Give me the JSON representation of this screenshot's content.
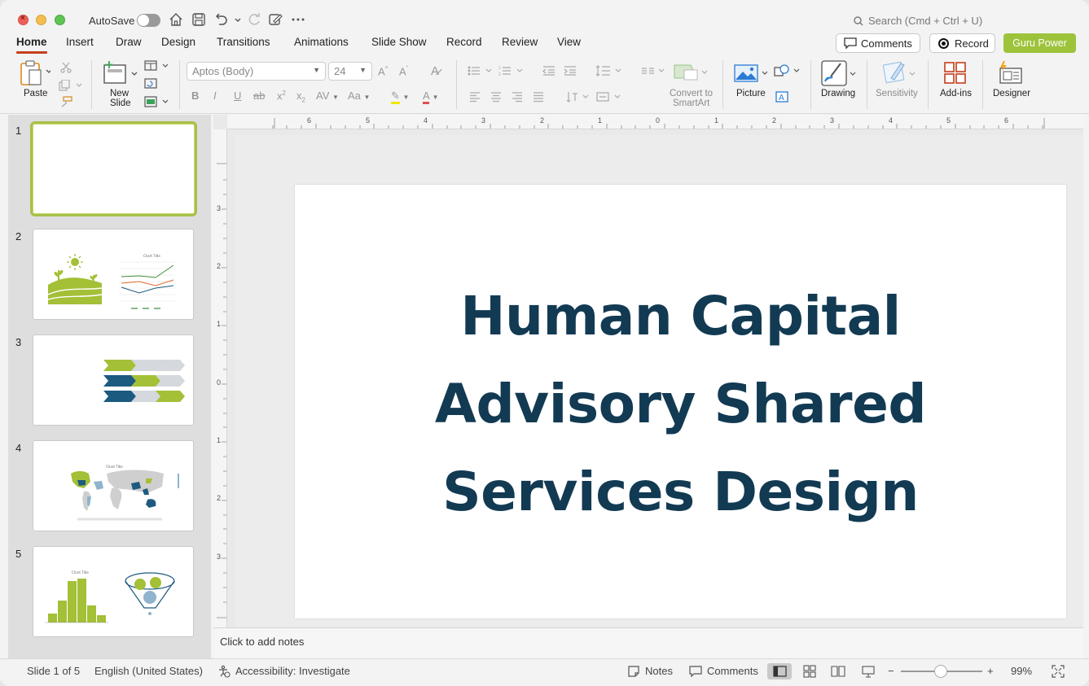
{
  "titlebar": {
    "autosave_label": "AutoSave",
    "search_placeholder": "Search (Cmd + Ctrl + U)"
  },
  "menu": {
    "tabs": [
      "Home",
      "Insert",
      "Draw",
      "Design",
      "Transitions",
      "Animations",
      "Slide Show",
      "Record",
      "Review",
      "View"
    ],
    "active_tab": "Home",
    "comments_label": "Comments",
    "record_label": "Record",
    "guru_label": "Guru Power"
  },
  "ribbon": {
    "paste_label": "Paste",
    "new_slide_label_1": "New",
    "new_slide_label_2": "Slide",
    "font_name": "Aptos (Body)",
    "font_size": "24",
    "convert_label_1": "Convert to",
    "convert_label_2": "SmartArt",
    "picture_label": "Picture",
    "drawing_label": "Drawing",
    "sensitivity_label": "Sensitivity",
    "addins_label": "Add-ins",
    "designer_label": "Designer"
  },
  "slides": {
    "numbers": [
      "1",
      "2",
      "3",
      "4",
      "5"
    ],
    "selected": "1",
    "thumb2_chart_title": "Chart Title",
    "thumb4_chart_title": "Chart Title",
    "thumb5_chart_title": "Chart Title"
  },
  "slide": {
    "title_line1": "Human Capital",
    "title_line2": "Advisory Shared",
    "title_line3": "Services Design"
  },
  "notes": {
    "placeholder": "Click to add notes"
  },
  "status": {
    "slide_counter": "Slide 1 of 5",
    "language": "English (United States)",
    "accessibility": "Accessibility: Investigate",
    "notes_label": "Notes",
    "comments_label": "Comments",
    "zoom": "99%"
  },
  "ruler": {
    "h_labels": [
      "6",
      "5",
      "4",
      "3",
      "2",
      "1",
      "0",
      "1",
      "2",
      "3",
      "4",
      "5",
      "6"
    ],
    "v_labels": [
      "3",
      "2",
      "1",
      "0",
      "1",
      "2",
      "3"
    ]
  },
  "colors": {
    "accent_green": "#9dc33b",
    "title_navy": "#123a53",
    "tab_underline": "#c43e1c",
    "chevron_navy": "#1d5a80"
  }
}
